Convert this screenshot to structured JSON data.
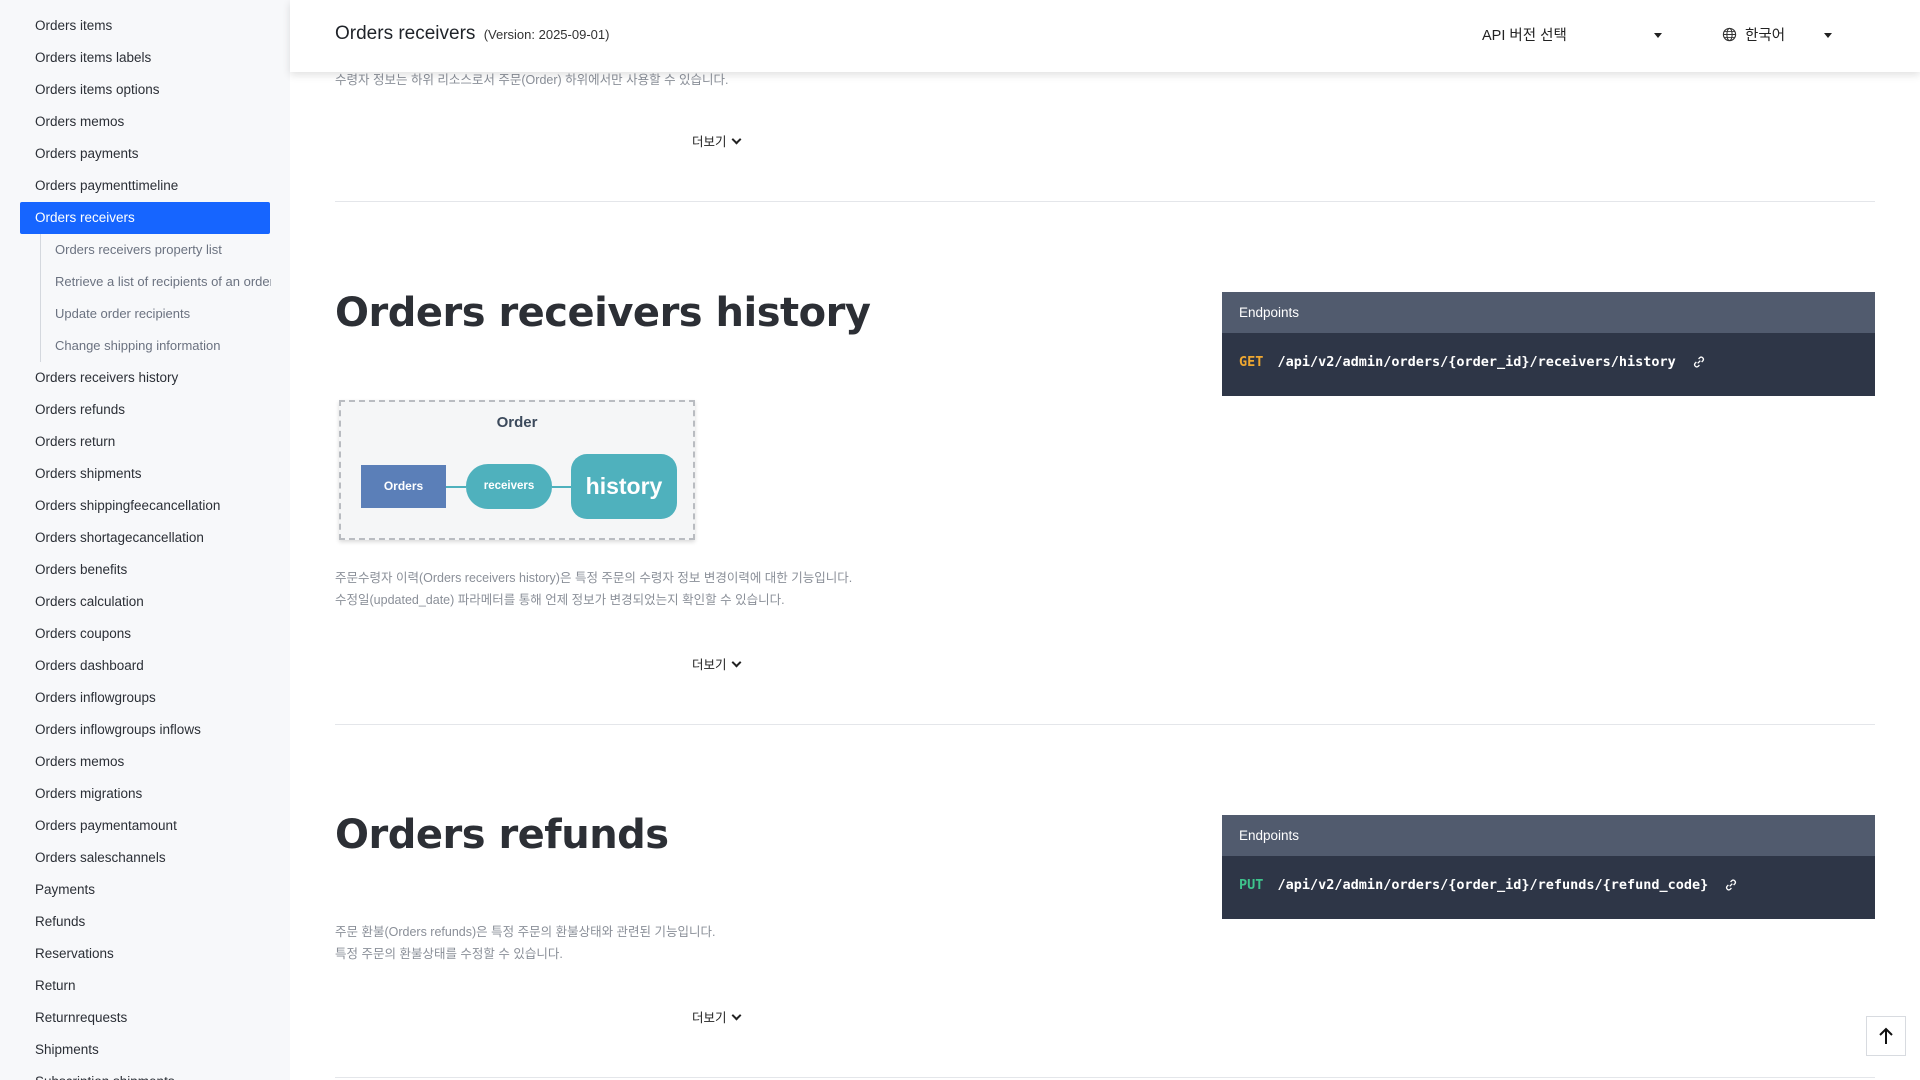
{
  "sidebar": {
    "items": [
      {
        "label": "Orders items"
      },
      {
        "label": "Orders items labels"
      },
      {
        "label": "Orders items options"
      },
      {
        "label": "Orders memos"
      },
      {
        "label": "Orders payments"
      },
      {
        "label": "Orders paymenttimeline"
      },
      {
        "label": "Orders receivers"
      }
    ],
    "subitems": [
      {
        "label": "Orders receivers property list"
      },
      {
        "label": "Retrieve a list of recipients of an order"
      },
      {
        "label": "Update order recipients"
      },
      {
        "label": "Change shipping information"
      }
    ],
    "items_after": [
      {
        "label": "Orders receivers history"
      },
      {
        "label": "Orders refunds"
      },
      {
        "label": "Orders return"
      },
      {
        "label": "Orders shipments"
      },
      {
        "label": "Orders shippingfeecancellation"
      },
      {
        "label": "Orders shortagecancellation"
      },
      {
        "label": "Orders benefits"
      },
      {
        "label": "Orders calculation"
      },
      {
        "label": "Orders coupons"
      },
      {
        "label": "Orders dashboard"
      },
      {
        "label": "Orders inflowgroups"
      },
      {
        "label": "Orders inflowgroups inflows"
      },
      {
        "label": "Orders memos"
      },
      {
        "label": "Orders migrations"
      },
      {
        "label": "Orders paymentamount"
      },
      {
        "label": "Orders saleschannels"
      },
      {
        "label": "Payments"
      },
      {
        "label": "Refunds"
      },
      {
        "label": "Reservations"
      },
      {
        "label": "Return"
      },
      {
        "label": "Returnrequests"
      },
      {
        "label": "Shipments"
      },
      {
        "label": "Subscription shipments"
      }
    ]
  },
  "header": {
    "title": "Orders receivers",
    "version": "(Version: 2025-09-01)",
    "api_select_label": "API 버전 선택",
    "language_label": "한국어"
  },
  "intro": {
    "text": "수령자 정보는 하위 리소스로서 주문(Order) 하위에서만 사용할 수 있습니다.",
    "more_label": "더보기"
  },
  "sections": [
    {
      "title": "Orders receivers history",
      "endpoint_header": "Endpoints",
      "method": "GET",
      "path": "/api/v2/admin/orders/{order_id}/receivers/history",
      "diagram": {
        "title": "Order",
        "nodes": [
          "Orders",
          "receivers",
          "history"
        ]
      },
      "desc_line1": "주문수령자 이력(Orders receivers history)은 특정 주문의 수령자 정보 변경이력에 대한 기능입니다.",
      "desc_line2": "수정일(updated_date) 파라메터를 통해 언제 정보가 변경되었는지 확인할 수 있습니다.",
      "more_label": "더보기"
    },
    {
      "title": "Orders refunds",
      "endpoint_header": "Endpoints",
      "method": "PUT",
      "path": "/api/v2/admin/orders/{order_id}/refunds/{refund_code}",
      "desc_line1": "주문 환불(Orders refunds)은 특정 주문의 환불상태와 관련된 기능입니다.",
      "desc_line2": "특정 주문의 환불상태를 수정할 수 있습니다.",
      "more_label": "더보기"
    }
  ],
  "colors": {
    "active_nav": "#1665ff",
    "endpoint_bg": "#2e3647",
    "get_method": "#f0a830",
    "put_method": "#3ec48c",
    "diagram_node_blue": "#5b7fb8",
    "diagram_node_teal": "#4fb1bd"
  },
  "icons": [
    "globe-icon",
    "caret-down-icon",
    "link-icon",
    "chevron-down-icon",
    "arrow-up-icon"
  ]
}
